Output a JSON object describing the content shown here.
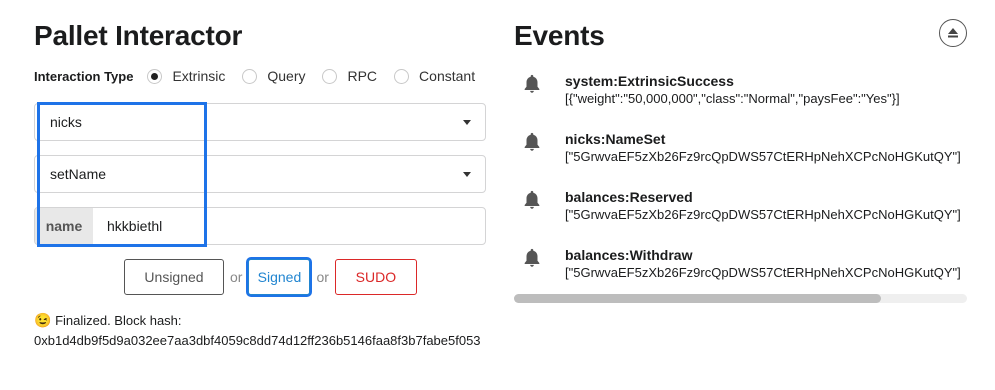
{
  "left": {
    "title": "Pallet Interactor",
    "interaction_type_label": "Interaction Type",
    "interaction_options": [
      "Extrinsic",
      "Query",
      "RPC",
      "Constant"
    ],
    "selected_option": "Extrinsic",
    "pallet_value": "nicks",
    "callable_value": "setName",
    "param_label": "name",
    "param_value": "hkkbiethl",
    "buttons": {
      "unsigned": "Unsigned",
      "or": "or",
      "signed": "Signed",
      "sudo": "SUDO"
    },
    "status_emoji": "😉",
    "status_text": "Finalized. Block hash:",
    "block_hash": "0xb1d4db9f5d9a032ee7aa3dbf4059c8dd74d12ff236b5146faa8f3b7fabe5f053"
  },
  "right": {
    "title": "Events",
    "events": [
      {
        "name": "system:ExtrinsicSuccess",
        "data": "[{\"weight\":\"50,000,000\",\"class\":\"Normal\",\"paysFee\":\"Yes\"}]"
      },
      {
        "name": "nicks:NameSet",
        "data": "[\"5GrwvaEF5zXb26Fz9rcQpDWS57CtERHpNehXCPcNoHGKutQY\"]"
      },
      {
        "name": "balances:Reserved",
        "data": "[\"5GrwvaEF5zXb26Fz9rcQpDWS57CtERHpNehXCPcNoHGKutQY\"]"
      },
      {
        "name": "balances:Withdraw",
        "data": "[\"5GrwvaEF5zXb26Fz9rcQpDWS57CtERHpNehXCPcNoHGKutQY\"]"
      }
    ],
    "scroll_fraction": 0.81
  },
  "colors": {
    "accent": "#1e73e8",
    "signed": "#2185d0",
    "sudo": "#db2828"
  },
  "icons": {
    "event": "bell-icon",
    "clear": "eject-icon"
  }
}
